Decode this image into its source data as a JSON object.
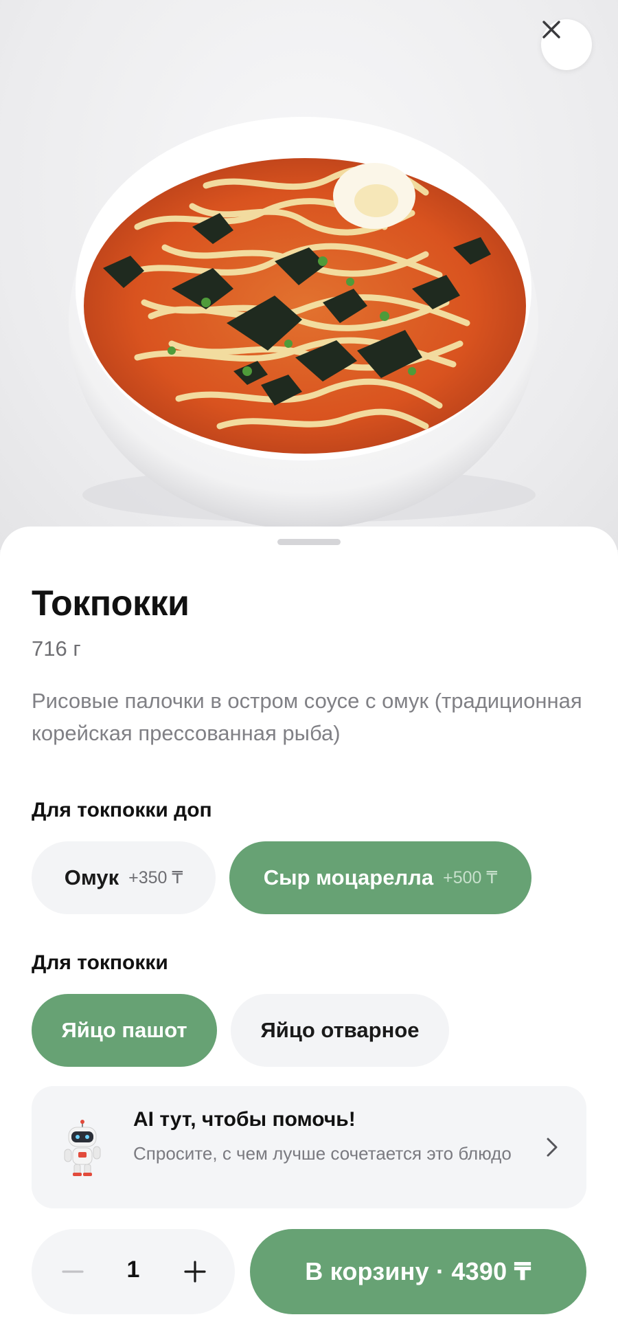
{
  "product": {
    "name": "Токпокки",
    "weight": "716 г",
    "description": "Рисовые палочки в остром соусе с омук (традиционная корейская прессованная рыба)",
    "image_alt": "Токпокки"
  },
  "option_groups": [
    {
      "title": "Для токпокки доп",
      "options": [
        {
          "label": "Омук",
          "price": "+350 ₸",
          "selected": false
        },
        {
          "label": "Сыр моцарелла",
          "price": "+500 ₸",
          "selected": true
        }
      ]
    },
    {
      "title": "Для токпокки",
      "options": [
        {
          "label": "Яйцо пашот",
          "selected": true
        },
        {
          "label": "Яйцо отварное",
          "selected": false
        }
      ]
    }
  ],
  "ai_helper": {
    "title": "AI тут, чтобы помочь!",
    "subtitle": "Спросите, с чем лучше сочетается это блюдо",
    "icon": "robot-mascot-icon"
  },
  "cart": {
    "quantity": "1",
    "add_label": "В корзину · 4390 ₸"
  },
  "icons": {
    "close": "close-icon",
    "minus": "minus-icon",
    "plus": "plus-icon",
    "chevron": "chevron-right-icon"
  },
  "colors": {
    "accent": "#67a274",
    "chip_inactive": "#f3f4f6",
    "text_primary": "#111111",
    "text_secondary": "#808085"
  }
}
